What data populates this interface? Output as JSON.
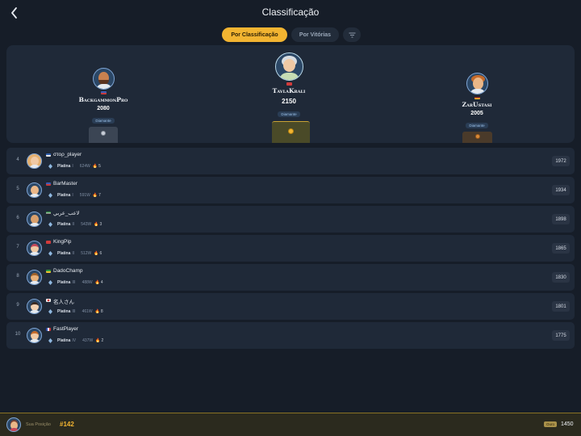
{
  "header": {
    "title": "Classificação",
    "back_icon": "chevron-left-icon"
  },
  "tabs": [
    {
      "label": "Por Classificação",
      "active": true
    },
    {
      "label": "Por Vitórias",
      "active": false
    }
  ],
  "filter_icon": "filter-icon",
  "podium": {
    "first": {
      "name": "TavlaKrali",
      "score": "2150",
      "tier": "Diamante",
      "medal": "gold-medal-icon"
    },
    "second": {
      "name": "BackgammonPro",
      "score": "2080",
      "tier": "Diamante",
      "medal": "silver-medal-icon"
    },
    "third": {
      "name": "ZarUstasi",
      "score": "2005",
      "tier": "Diamante",
      "medal": "bronze-medal-icon"
    }
  },
  "rows": [
    {
      "rank": "4",
      "name": "στορ_player",
      "tier": "Platina",
      "level": "I",
      "wins": "624W",
      "streak": "5",
      "rating": "1972"
    },
    {
      "rank": "5",
      "name": "BarMaster",
      "tier": "Platina",
      "level": "I",
      "wins": "591W",
      "streak": "7",
      "rating": "1934"
    },
    {
      "rank": "6",
      "name": "لاعب_عربي",
      "tier": "Platina",
      "level": "II",
      "wins": "543W",
      "streak": "3",
      "rating": "1898"
    },
    {
      "rank": "7",
      "name": "KingPip",
      "tier": "Platina",
      "level": "II",
      "wins": "512W",
      "streak": "6",
      "rating": "1865"
    },
    {
      "rank": "8",
      "name": "DadoChamp",
      "tier": "Platina",
      "level": "III",
      "wins": "488W",
      "streak": "4",
      "rating": "1830"
    },
    {
      "rank": "9",
      "name": "名人さん",
      "tier": "Platina",
      "level": "III",
      "wins": "461W",
      "streak": "8",
      "rating": "1801"
    },
    {
      "rank": "10",
      "name": "FastPlayer",
      "tier": "Platina",
      "level": "IV",
      "wins": "437W",
      "streak": "2",
      "rating": "1775"
    }
  ],
  "footer": {
    "label": "Sua Posição",
    "rank": "#142",
    "badge": "Ouro",
    "rating": "1450"
  },
  "colors": {
    "accent": "#f2b431",
    "background": "#161d28",
    "card": "#1f2938",
    "diamond": "#9cc3ec"
  }
}
